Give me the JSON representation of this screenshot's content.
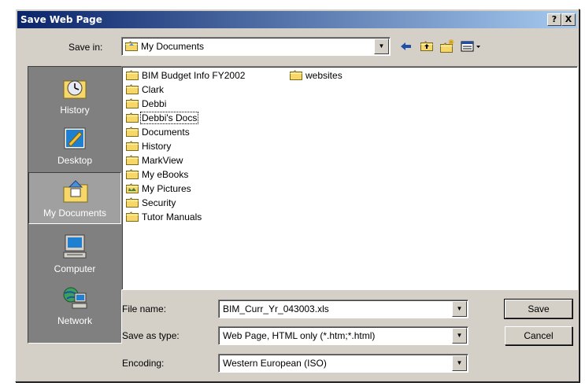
{
  "window": {
    "title": "Save Web Page",
    "help_label": "?",
    "close_label": "X"
  },
  "save_in": {
    "label": "Save in:",
    "value": "My Documents",
    "icon": "my-documents-icon"
  },
  "toolbar": {
    "back_icon": "back-arrow-icon",
    "up_icon": "up-one-level-icon",
    "new_folder_icon": "new-folder-icon",
    "views_icon": "views-menu-icon"
  },
  "places": [
    {
      "label": "History",
      "icon": "history-icon"
    },
    {
      "label": "Desktop",
      "icon": "desktop-icon"
    },
    {
      "label": "My Documents",
      "icon": "my-documents-icon",
      "selected": true
    },
    {
      "label": "Computer",
      "icon": "computer-icon"
    },
    {
      "label": "Network",
      "icon": "network-icon"
    }
  ],
  "files": {
    "column1": [
      "BIM Budget Info FY2002",
      "Clark",
      "Debbi",
      "Debbi's Docs",
      "Documents",
      "History",
      "MarkView",
      "My eBooks",
      "My Pictures",
      "Security",
      "Tutor Manuals"
    ],
    "column2": [
      "websites"
    ]
  },
  "form": {
    "file_name_label": "File name:",
    "file_name_value": "BIM_Curr_Yr_043003.xls",
    "save_type_label": "Save as type:",
    "save_type_value": "Web Page, HTML only (*.htm;*.html)",
    "encoding_label": "Encoding:",
    "encoding_value": "Western European (ISO)"
  },
  "buttons": {
    "save": "Save",
    "cancel": "Cancel"
  },
  "colors": {
    "face": "#d4d0c8",
    "title_start": "#0a246a",
    "title_end": "#a6caf0",
    "places_bg": "#808080",
    "folder": "#f7d768"
  }
}
